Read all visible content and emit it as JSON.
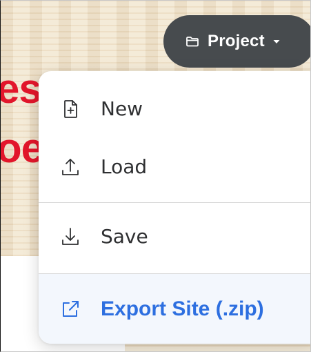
{
  "background": {
    "heading_fragment_line1": "es",
    "heading_fragment_line2": "oe",
    "heading_color": "#e2162b"
  },
  "project_button": {
    "label": "Project",
    "icon": "folder-icon",
    "caret_icon": "caret-down-icon",
    "background_color": "#474b4e"
  },
  "menu": {
    "items": [
      {
        "label": "New",
        "icon": "file-plus-icon"
      },
      {
        "label": "Load",
        "icon": "upload-icon"
      },
      {
        "label": "Save",
        "icon": "download-icon"
      },
      {
        "label": "Export Site (.zip)",
        "icon": "external-link-icon",
        "highlight_color": "#2d6fe0"
      }
    ]
  }
}
